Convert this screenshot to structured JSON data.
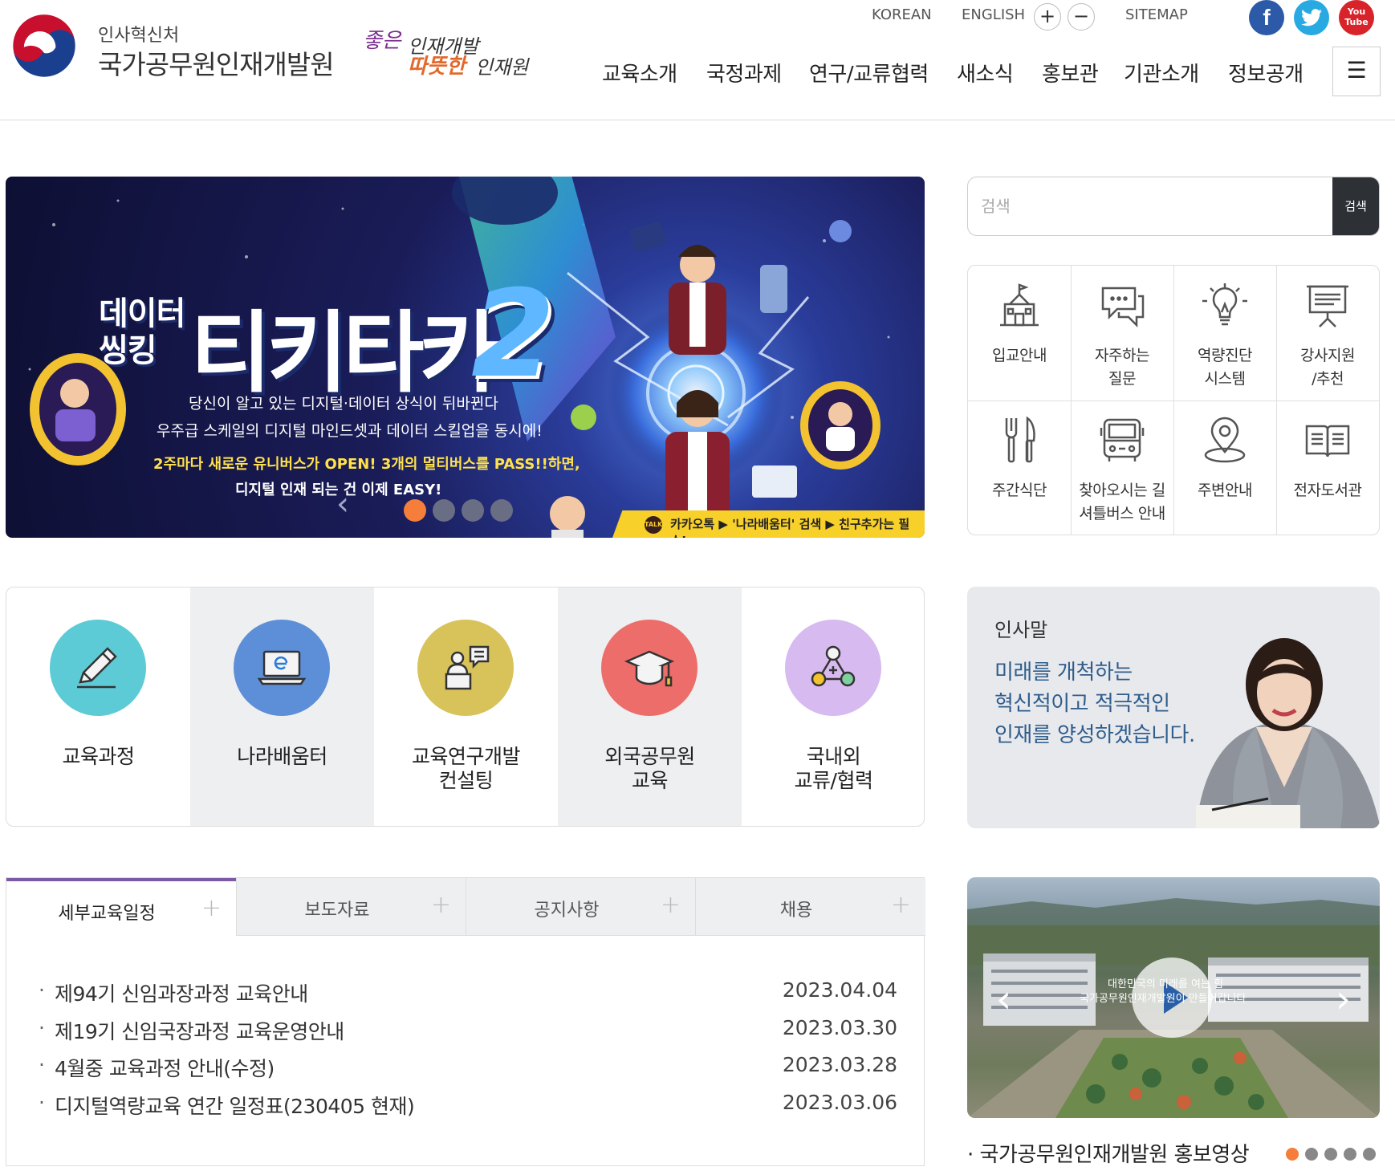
{
  "header": {
    "org_sub": "인사혁신처",
    "org_name": "국가공무원인재개발원",
    "slogan": {
      "part1": "좋은",
      "part2": "인재개발",
      "part3": "따뜻한",
      "part4": "인재원"
    },
    "util": {
      "korean": "KOREAN",
      "english": "ENGLISH",
      "zoom_in": "+",
      "zoom_out": "−",
      "sitemap": "SITEMAP"
    },
    "sns": {
      "facebook": "f",
      "twitter": "t",
      "youtube_line1": "You",
      "youtube_line2": "Tube"
    },
    "nav": [
      "교육소개",
      "국정과제",
      "연구/교류협력",
      "새소식",
      "홍보관",
      "기관소개",
      "정보공개"
    ],
    "menu_icon": "☰"
  },
  "hero": {
    "title_small_1": "데이터",
    "title_small_2": "씽킹",
    "title_main": "티키타카",
    "title_num": "2",
    "line1": "당신이 알고 있는 디지털·데이터 상식이 뒤바뀐다",
    "line2": "우주급 스케일의 디지털 마인드셋과 데이터 스킬업을 동시에!",
    "line3": "2주마다 새로운 유니버스가 OPEN! 3개의 멀티버스를 PASS!!하면,",
    "line4": "디지털 인재 되는 건 이제 EASY!",
    "kakao_badge": "TALK",
    "kakao_text": "카카오톡 ▶ '나라배움터' 검색 ▶ 친구추가는 필수!",
    "prev": "‹",
    "slide_count": 4,
    "active_slide": 0
  },
  "search": {
    "placeholder": "검색",
    "button": "검색"
  },
  "quick_links": [
    {
      "line1": "입교안내",
      "line2": "",
      "icon": "school-icon"
    },
    {
      "line1": "자주하는",
      "line2": "질문",
      "icon": "chat-bubble-icon"
    },
    {
      "line1": "역량진단",
      "line2": "시스템",
      "icon": "lightbulb-icon"
    },
    {
      "line1": "강사지원",
      "line2": "/추천",
      "icon": "presentation-board-icon"
    },
    {
      "line1": "주간식단",
      "line2": "",
      "icon": "fork-knife-icon"
    },
    {
      "line1": "찾아오시는 길",
      "line2": "셔틀버스 안내",
      "icon": "bus-icon"
    },
    {
      "line1": "주변안내",
      "line2": "",
      "icon": "map-pin-icon"
    },
    {
      "line1": "전자도서관",
      "line2": "",
      "icon": "book-icon"
    }
  ],
  "services": [
    {
      "line1": "교육과정",
      "line2": "",
      "color": "#5ccbd6",
      "icon": "pencil-icon"
    },
    {
      "line1": "나라배움터",
      "line2": "",
      "color": "#5d8fd8",
      "icon": "laptop-icon"
    },
    {
      "line1": "교육연구개발",
      "line2": "컨설팅",
      "color": "#d8c35a",
      "icon": "lecturer-icon"
    },
    {
      "line1": "외국공무원",
      "line2": "교육",
      "color": "#ed6d6a",
      "icon": "graduation-cap-icon"
    },
    {
      "line1": "국내외",
      "line2": "교류/협력",
      "color": "#d6baf0",
      "icon": "network-icon"
    }
  ],
  "greeting": {
    "title": "인사말",
    "line1": "미래를 개척하는",
    "line2": "혁신적이고 적극적인",
    "line3": "인재를 양성하겠습니다."
  },
  "board": {
    "tabs": [
      "세부교육일정",
      "보도자료",
      "공지사항",
      "채용"
    ],
    "active_tab": 0,
    "items": [
      {
        "title": "제94기 신임과장과정 교육안내",
        "date": "2023.04.04"
      },
      {
        "title": "제19기 신임국장과정 교육운영안내",
        "date": "2023.03.30"
      },
      {
        "title": "4월중 교육과정 안내(수정)",
        "date": "2023.03.28"
      },
      {
        "title": "디지털역량교육 연간 일정표(230405 현재)",
        "date": "2023.03.06"
      }
    ]
  },
  "video": {
    "caption1": "대한민국의 미래를 여는 힘",
    "caption2": "국가공무원인재개발원이 만들어갑니다",
    "title": "국가공무원인재개발원 홍보영상",
    "slide_count": 5,
    "active_slide": 0,
    "prev": "‹",
    "next": "›"
  },
  "colors": {
    "accent_purple": "#7c5aa6",
    "active_dot": "#f47e3a",
    "greeting_text": "#2f5d8c",
    "search_button": "#2d3035"
  }
}
